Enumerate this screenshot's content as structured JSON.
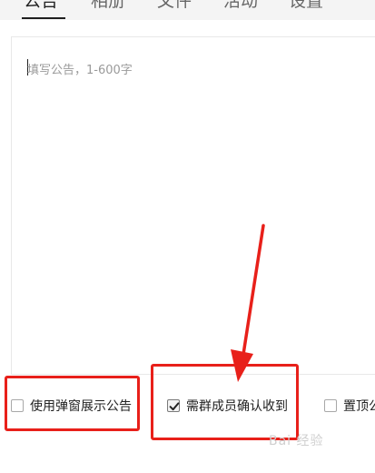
{
  "tabs": [
    {
      "label": "公告",
      "active": true
    },
    {
      "label": "相册",
      "active": false
    },
    {
      "label": "文件",
      "active": false
    },
    {
      "label": "活动",
      "active": false
    },
    {
      "label": "设置",
      "active": false
    }
  ],
  "editor": {
    "placeholder": "填写公告，1-600字"
  },
  "options": [
    {
      "label": "使用弹窗展示公告",
      "checked": false
    },
    {
      "label": "需群成员确认收到",
      "checked": true
    },
    {
      "label": "置顶公",
      "checked": false
    }
  ],
  "watermark": "Bai 经验",
  "colors": {
    "annotation": "#e8201a"
  }
}
